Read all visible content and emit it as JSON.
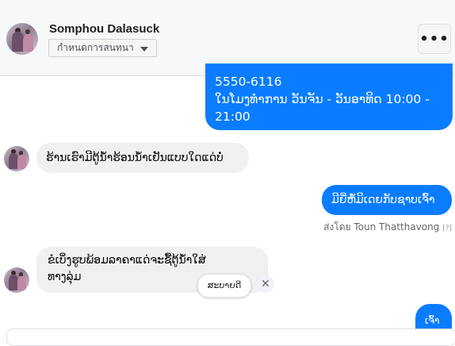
{
  "header": {
    "contact_name": "Somphou Dalasuck",
    "assign_label": "กำหนดการสนทนา",
    "more_label": "•••"
  },
  "messages": [
    {
      "side": "outgoing",
      "lines": [
        "5550-6116",
        "ໃນໂມງທຳການ ວັນຈັນ - ວັນອາທິດ  10:00 -",
        "21:00"
      ]
    },
    {
      "side": "incoming",
      "lines": [
        "ຮ້ານເຮົາມີຕູ້ນ້ຳຮ້ອນນ້ຳເຢັນແບບໃດແດ່ບໍ່"
      ]
    },
    {
      "side": "outgoing",
      "lines": [
        "ມີຍີ່ຫໍ້ມິເດຍກັບຊາບເຈົ້າ"
      ]
    },
    {
      "side": "incoming",
      "lines": [
        "ຂໍເບິ່ງຮູບພ້ອມລາຄາແດ່ຈະຊື້ຕູ້ນ້ຳໃສ່",
        "ທາງລຸ່ມ"
      ]
    },
    {
      "side": "outgoing",
      "lines": [
        "ເຈົ້າ"
      ]
    }
  ],
  "sent_by": {
    "label": "ส่งโดย",
    "agent": "Toun Thatthavong",
    "hint": "[?]"
  },
  "quick_reply": {
    "label": "ສະບາຍດີ",
    "close": "✕"
  }
}
